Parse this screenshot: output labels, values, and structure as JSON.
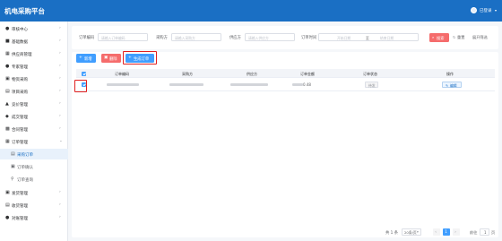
{
  "app": {
    "title": "机电采购平台",
    "user_name": "已登录"
  },
  "sidebar": {
    "items": [
      {
        "icon": "person",
        "label": "审核中心"
      },
      {
        "icon": "database",
        "label": "基础数据"
      },
      {
        "icon": "store",
        "label": "供应商管理"
      },
      {
        "icon": "people",
        "label": "专家管理"
      },
      {
        "icon": "cart",
        "label": "物资采购"
      },
      {
        "icon": "clipboard",
        "label": "项目采购"
      },
      {
        "icon": "bidding",
        "label": "竞价管理"
      },
      {
        "icon": "deal",
        "label": "成交管理"
      },
      {
        "icon": "contract",
        "label": "合同管理"
      },
      {
        "icon": "order",
        "label": "订单管理"
      },
      {
        "icon": "list",
        "label": "采购订单"
      },
      {
        "icon": "confirm",
        "label": "订单确认"
      },
      {
        "icon": "search",
        "label": "订单查询"
      },
      {
        "icon": "truck",
        "label": "发货管理"
      },
      {
        "icon": "inbox",
        "label": "收货管理"
      },
      {
        "icon": "money",
        "label": "对账管理"
      }
    ]
  },
  "filters": {
    "order_no_label": "订单编码",
    "order_no_placeholder": "请输入订单编码",
    "buyer_label": "采购方",
    "buyer_placeholder": "请输入采购方",
    "seller_label": "供应方",
    "seller_placeholder": "请输入供应方",
    "time_label": "订单时间",
    "start_placeholder": "开始日期",
    "range_sep": "至",
    "end_placeholder": "结束日期",
    "search_label": "搜索",
    "reset_label": "重置",
    "more_label": "展开筛选"
  },
  "toolbar": {
    "add_label": "新增",
    "delete_label": "删除",
    "create_order_label": "生成订单"
  },
  "table": {
    "columns": [
      "订单编码",
      "采购方",
      "供应方",
      "订单金额",
      "订单状态",
      "操作"
    ],
    "rows": [
      {
        "amount_suffix": "0.48",
        "status": "待发",
        "edit_label": "编辑"
      }
    ]
  },
  "pagination": {
    "total_text": "共 1 条",
    "page_size": "20条/页",
    "current_page": "1",
    "goto_label": "前往",
    "goto_value": "1",
    "goto_unit": "页"
  },
  "colors": {
    "primary": "#1a6fc4",
    "danger": "#f56c6c",
    "highlight": "#e02020"
  }
}
